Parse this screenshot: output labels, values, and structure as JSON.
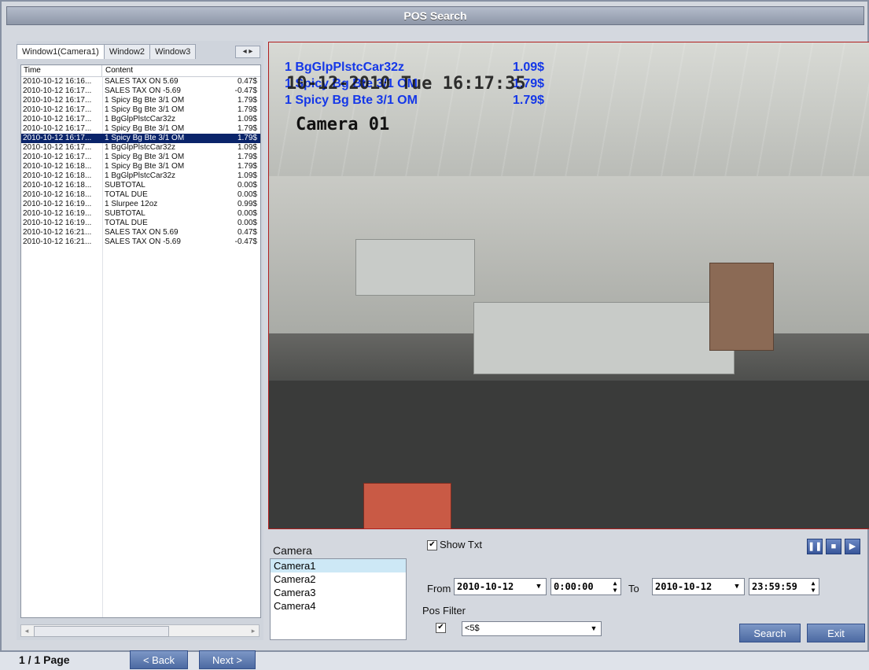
{
  "window": {
    "title": "POS Search"
  },
  "tabs": [
    {
      "label": "Window1(Camera1)"
    },
    {
      "label": "Window2"
    },
    {
      "label": "Window3"
    }
  ],
  "tab_scroll": {
    "left": "◂",
    "right": "▸"
  },
  "list": {
    "headers": {
      "time": "Time",
      "content": "Content"
    },
    "rows": [
      {
        "time": "2010-10-12 16:16...",
        "content": "SALES TAX ON 5.69",
        "amount": "0.47$"
      },
      {
        "time": "2010-10-12 16:17...",
        "content": "SALES TAX ON -5.69",
        "amount": "-0.47$"
      },
      {
        "time": "2010-10-12 16:17...",
        "content": "1  Spicy Bg Bte 3/1 OM",
        "amount": "1.79$"
      },
      {
        "time": "2010-10-12 16:17...",
        "content": "1  Spicy Bg Bte 3/1 OM",
        "amount": "1.79$"
      },
      {
        "time": "2010-10-12 16:17...",
        "content": "1  BgGlpPlstcCar32z",
        "amount": "1.09$"
      },
      {
        "time": "2010-10-12 16:17...",
        "content": "1  Spicy Bg Bte 3/1 OM",
        "amount": "1.79$"
      },
      {
        "time": "2010-10-12 16:17...",
        "content": "1  Spicy Bg Bte 3/1 OM",
        "amount": "1.79$",
        "selected": true
      },
      {
        "time": "2010-10-12 16:17...",
        "content": "1  BgGlpPlstcCar32z",
        "amount": "1.09$"
      },
      {
        "time": "2010-10-12 16:17...",
        "content": "1  Spicy Bg Bte 3/1 OM",
        "amount": "1.79$"
      },
      {
        "time": "2010-10-12 16:18...",
        "content": "1  Spicy Bg Bte 3/1 OM",
        "amount": "1.79$"
      },
      {
        "time": "2010-10-12 16:18...",
        "content": "1  BgGlpPlstcCar32z",
        "amount": "1.09$"
      },
      {
        "time": "2010-10-12 16:18...",
        "content": "SUBTOTAL",
        "amount": "0.00$"
      },
      {
        "time": "2010-10-12 16:18...",
        "content": "TOTAL DUE",
        "amount": "0.00$"
      },
      {
        "time": "2010-10-12 16:19...",
        "content": "1  Slurpee 12oz",
        "amount": "0.99$"
      },
      {
        "time": "2010-10-12 16:19...",
        "content": "SUBTOTAL",
        "amount": "0.00$"
      },
      {
        "time": "2010-10-12 16:19...",
        "content": "TOTAL DUE",
        "amount": "0.00$"
      },
      {
        "time": "2010-10-12 16:21...",
        "content": "SALES TAX ON 5.69",
        "amount": "0.47$"
      },
      {
        "time": "2010-10-12 16:21...",
        "content": "SALES TAX ON -5.69",
        "amount": "-0.47$"
      }
    ]
  },
  "pagination": {
    "page_info": "1 / 1 Page",
    "back_label": "< Back",
    "next_label": "Next >"
  },
  "video": {
    "overlay_lines": [
      {
        "text": "1  BgGlpPlstcCar32z",
        "amount": "1.09$"
      },
      {
        "text": "1  Spicy Bg Bte 3/1 OM",
        "amount": "1.79$"
      },
      {
        "text": "1  Spicy Bg Bte 3/1 OM",
        "amount": "1.79$"
      }
    ],
    "osd_datetime": "10-12-2010 Tue 16:17:35",
    "osd_camera": "Camera 01"
  },
  "camera_panel": {
    "label": "Camera",
    "items": [
      "Camera1",
      "Camera2",
      "Camera3",
      "Camera4"
    ],
    "selected_index": 0
  },
  "show_txt": {
    "label": "Show Txt",
    "checked": true
  },
  "search": {
    "from_label": "From",
    "from_date": "2010-10-12",
    "from_time": "0:00:00",
    "to_label": "To",
    "to_date": "2010-10-12",
    "to_time": "23:59:59"
  },
  "pos_filter": {
    "label": "Pos Filter",
    "checked": true,
    "value": "<5$"
  },
  "buttons": {
    "search_label": "Search",
    "exit_label": "Exit"
  },
  "playback_icons": [
    "pause-icon",
    "stop-icon",
    "step-forward-icon"
  ],
  "colors": {
    "title_bar": "#8e97a8",
    "selection": "#0a246a",
    "overlay_text": "#1437e8",
    "video_border": "#b01d1d",
    "button_blue": "#4c6aa2"
  }
}
